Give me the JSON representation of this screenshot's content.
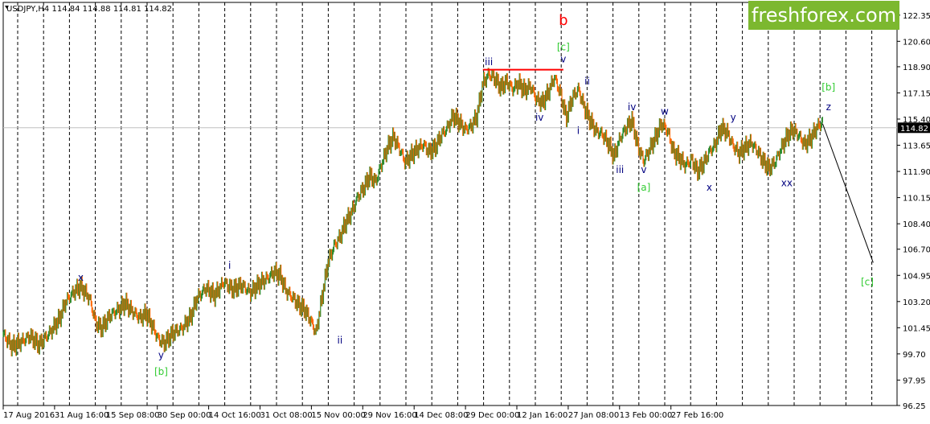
{
  "chart_data": {
    "type": "candlestick",
    "symbol_header": "USDJPY,H4  114.84 114.88 114.81 114.82",
    "current_price": "114.82",
    "ylim": [
      96.25,
      123.2
    ],
    "y_ticks": [
      "122.35",
      "120.60",
      "118.90",
      "117.15",
      "115.40",
      "113.65",
      "111.90",
      "110.15",
      "108.40",
      "106.70",
      "104.95",
      "103.20",
      "101.45",
      "99.70",
      "97.95",
      "96.25"
    ],
    "x_ticks": [
      "17 Aug 2016",
      "31 Aug 16:00",
      "15 Sep 08:00",
      "30 Sep 00:00",
      "14 Oct 16:00",
      "31 Oct 08:00",
      "15 Nov 00:00",
      "29 Nov 16:00",
      "14 Dec 08:00",
      "29 Dec 00:00",
      "12 Jan 16:00",
      "27 Jan 08:00",
      "13 Feb 00:00",
      "27 Feb 16:00"
    ],
    "price_path": [
      [
        0,
        101.0
      ],
      [
        3,
        100.2
      ],
      [
        6,
        100.5
      ],
      [
        9,
        100.9
      ],
      [
        12,
        100.3
      ],
      [
        16,
        101.2
      ],
      [
        19,
        102.1
      ],
      [
        21,
        103.2
      ],
      [
        24,
        103.9
      ],
      [
        26,
        104.2
      ],
      [
        29,
        103.4
      ],
      [
        31,
        101.8
      ],
      [
        33,
        101.4
      ],
      [
        36,
        102.3
      ],
      [
        39,
        102.7
      ],
      [
        41,
        103.1
      ],
      [
        43,
        102.6
      ],
      [
        46,
        102.1
      ],
      [
        48,
        102.4
      ],
      [
        50,
        101.6
      ],
      [
        52,
        100.7
      ],
      [
        54,
        100.4
      ],
      [
        57,
        101.1
      ],
      [
        60,
        101.4
      ],
      [
        63,
        102.2
      ],
      [
        65,
        103.4
      ],
      [
        68,
        104.1
      ],
      [
        71,
        103.6
      ],
      [
        74,
        104.5
      ],
      [
        77,
        104.0
      ],
      [
        80,
        104.3
      ],
      [
        83,
        103.8
      ],
      [
        86,
        104.4
      ],
      [
        89,
        104.8
      ],
      [
        91,
        105.2
      ],
      [
        93,
        104.9
      ],
      [
        95,
        103.9
      ],
      [
        97,
        103.5
      ],
      [
        99,
        103.0
      ],
      [
        101,
        102.7
      ],
      [
        103,
        102.0
      ],
      [
        105,
        101.1
      ],
      [
        107,
        103.5
      ],
      [
        109,
        105.8
      ],
      [
        111,
        106.9
      ],
      [
        113,
        107.5
      ],
      [
        115,
        108.5
      ],
      [
        117,
        109.2
      ],
      [
        119,
        110.2
      ],
      [
        121,
        110.8
      ],
      [
        123,
        111.6
      ],
      [
        125,
        111.2
      ],
      [
        127,
        112.4
      ],
      [
        129,
        113.5
      ],
      [
        131,
        114.2
      ],
      [
        133,
        113.4
      ],
      [
        135,
        112.5
      ],
      [
        137,
        113.0
      ],
      [
        139,
        113.4
      ],
      [
        141,
        113.7
      ],
      [
        143,
        113.2
      ],
      [
        145,
        113.5
      ],
      [
        147,
        114.3
      ],
      [
        149,
        114.8
      ],
      [
        151,
        115.6
      ],
      [
        153,
        115.2
      ],
      [
        155,
        114.7
      ],
      [
        157,
        114.9
      ],
      [
        159,
        115.6
      ],
      [
        161,
        117.8
      ],
      [
        163,
        118.4
      ],
      [
        165,
        118.1
      ],
      [
        167,
        117.5
      ],
      [
        169,
        117.9
      ],
      [
        171,
        117.4
      ],
      [
        173,
        117.8
      ],
      [
        175,
        117.3
      ],
      [
        177,
        117.6
      ],
      [
        179,
        116.7
      ],
      [
        181,
        116.5
      ],
      [
        183,
        117.2
      ],
      [
        185,
        118.2
      ],
      [
        187,
        117.1
      ],
      [
        189,
        115.5
      ],
      [
        191,
        116.8
      ],
      [
        193,
        117.4
      ],
      [
        195,
        116.2
      ],
      [
        197,
        115.3
      ],
      [
        199,
        114.6
      ],
      [
        201,
        114.4
      ],
      [
        203,
        113.8
      ],
      [
        205,
        112.9
      ],
      [
        207,
        114.1
      ],
      [
        209,
        114.8
      ],
      [
        211,
        115.3
      ],
      [
        213,
        113.6
      ],
      [
        215,
        112.6
      ],
      [
        217,
        113.4
      ],
      [
        219,
        114.2
      ],
      [
        221,
        115.1
      ],
      [
        223,
        114.6
      ],
      [
        225,
        113.2
      ],
      [
        227,
        112.8
      ],
      [
        229,
        112.3
      ],
      [
        231,
        112.7
      ],
      [
        233,
        111.9
      ],
      [
        235,
        112.4
      ],
      [
        237,
        113.2
      ],
      [
        239,
        113.7
      ],
      [
        241,
        114.8
      ],
      [
        243,
        114.5
      ],
      [
        245,
        113.6
      ],
      [
        247,
        113.1
      ],
      [
        249,
        113.5
      ],
      [
        251,
        113.8
      ],
      [
        253,
        113.3
      ],
      [
        255,
        112.6
      ],
      [
        257,
        112.1
      ],
      [
        259,
        112.5
      ],
      [
        261,
        113.4
      ],
      [
        263,
        114.2
      ],
      [
        265,
        114.7
      ],
      [
        267,
        114.3
      ],
      [
        269,
        113.7
      ],
      [
        271,
        114.1
      ],
      [
        273,
        114.8
      ],
      [
        275,
        115.2
      ]
    ],
    "projection": [
      [
        275,
        115.1
      ],
      [
        292,
        105.8
      ]
    ],
    "resistance_line": {
      "x": [
        161,
        188
      ],
      "y": 118.7
    },
    "wave_labels": [
      {
        "text": "x",
        "x": 26,
        "y": 104.6,
        "color": "#000080"
      },
      {
        "text": "y",
        "x": 53,
        "y": 99.4,
        "color": "#000080"
      },
      {
        "text": "[b]",
        "x": 53,
        "y": 98.3,
        "color": "#33cc33"
      },
      {
        "text": "i",
        "x": 76,
        "y": 105.4,
        "color": "#000080"
      },
      {
        "text": "ii",
        "x": 113,
        "y": 100.4,
        "color": "#000080"
      },
      {
        "text": "iii",
        "x": 163,
        "y": 119.0,
        "color": "#000080"
      },
      {
        "text": "b",
        "x": 188,
        "y": 121.7,
        "color": "#ff0000"
      },
      {
        "text": "[c]",
        "x": 188,
        "y": 120.0,
        "color": "#33cc33"
      },
      {
        "text": "v",
        "x": 188,
        "y": 119.2,
        "color": "#000080"
      },
      {
        "text": "iv",
        "x": 180,
        "y": 115.3,
        "color": "#000080"
      },
      {
        "text": "ii",
        "x": 196,
        "y": 117.7,
        "color": "#000080"
      },
      {
        "text": "i",
        "x": 193,
        "y": 114.4,
        "color": "#000080"
      },
      {
        "text": "iii",
        "x": 207,
        "y": 111.8,
        "color": "#000080"
      },
      {
        "text": "iv",
        "x": 211,
        "y": 116.0,
        "color": "#000080"
      },
      {
        "text": "v",
        "x": 215,
        "y": 111.8,
        "color": "#000080"
      },
      {
        "text": "[a]",
        "x": 215,
        "y": 110.6,
        "color": "#33cc33"
      },
      {
        "text": "w",
        "x": 222,
        "y": 115.7,
        "color": "#000080"
      },
      {
        "text": "x",
        "x": 237,
        "y": 110.6,
        "color": "#000080"
      },
      {
        "text": "y",
        "x": 245,
        "y": 115.3,
        "color": "#000080"
      },
      {
        "text": "xx",
        "x": 263,
        "y": 110.9,
        "color": "#000080"
      },
      {
        "text": "[b]",
        "x": 277,
        "y": 117.3,
        "color": "#33cc33"
      },
      {
        "text": "z",
        "x": 277,
        "y": 116.0,
        "color": "#000080"
      },
      {
        "text": "[c]",
        "x": 290,
        "y": 104.3,
        "color": "#33cc33"
      }
    ]
  },
  "logo": {
    "text": "freshforex.com"
  }
}
